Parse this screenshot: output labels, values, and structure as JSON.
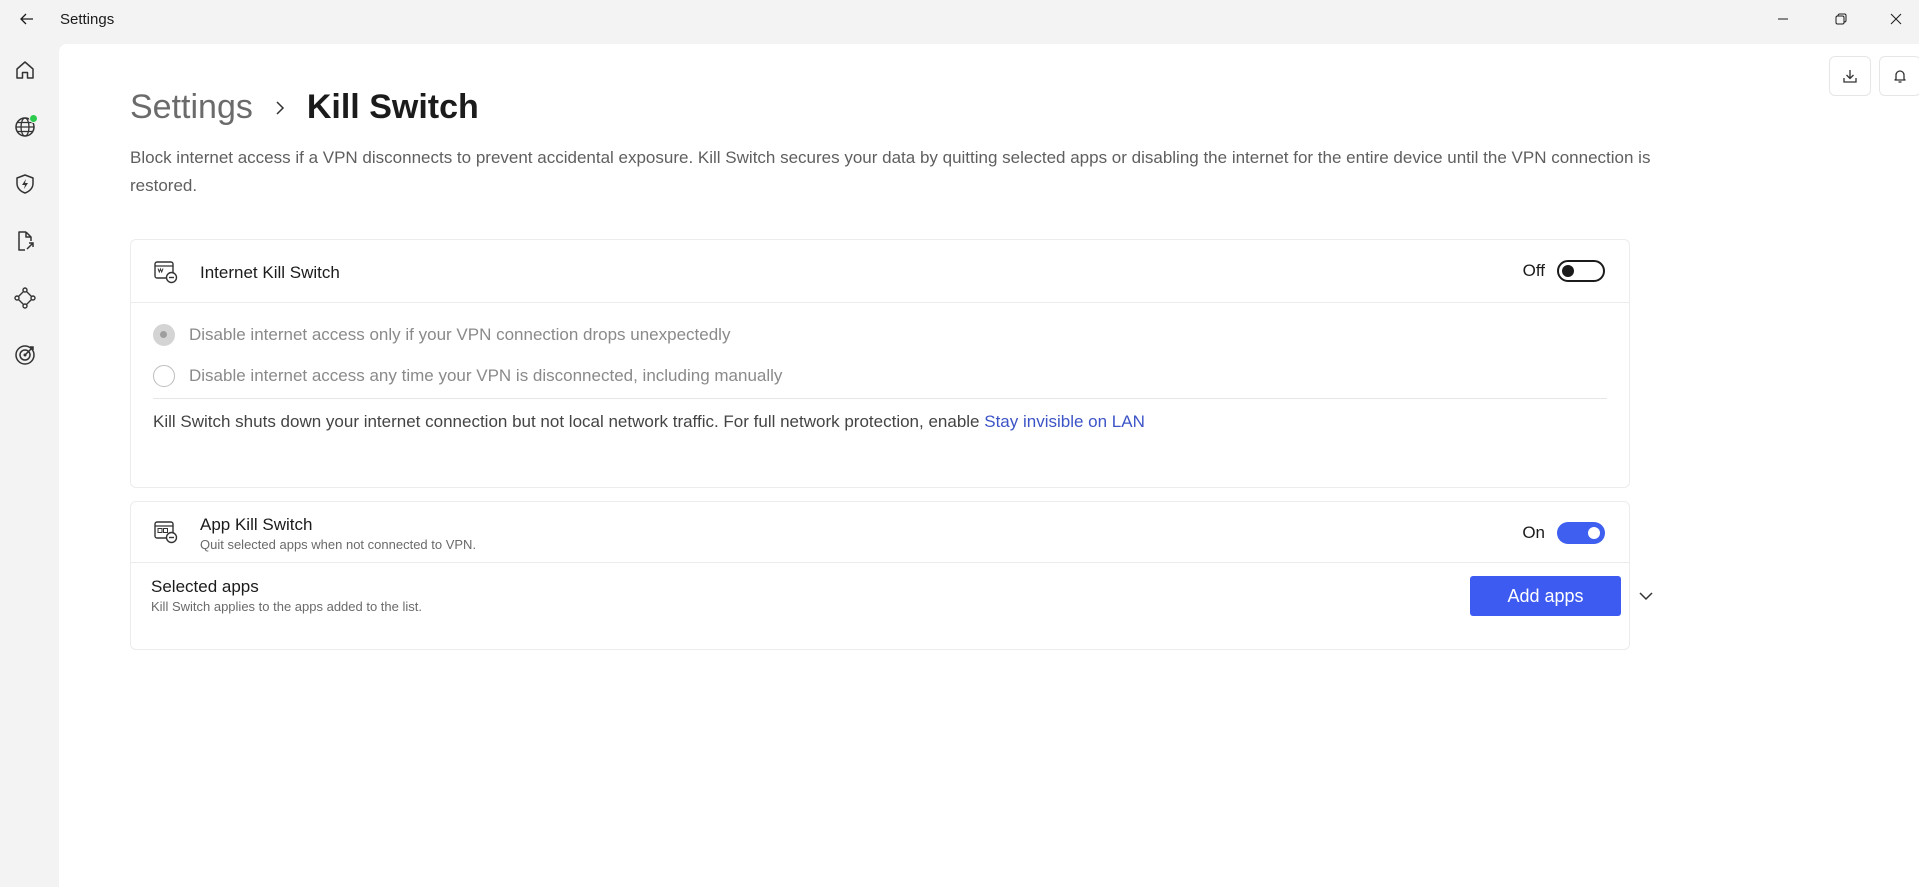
{
  "window": {
    "title": "Settings"
  },
  "sidebar": {
    "items": [
      {
        "name": "home-icon"
      },
      {
        "name": "globe-icon",
        "status_color": "#2bcb4e"
      },
      {
        "name": "shield-bolt-icon"
      },
      {
        "name": "file-share-icon"
      },
      {
        "name": "mesh-network-icon"
      },
      {
        "name": "target-icon"
      }
    ]
  },
  "header": {
    "breadcrumb_root": "Settings",
    "breadcrumb_current": "Kill Switch",
    "description": "Block internet access if a VPN disconnects to prevent accidental exposure. Kill Switch secures your data by quitting selected apps or disabling the internet for the entire device until the VPN connection is restored."
  },
  "internet_kill_switch": {
    "title": "Internet Kill Switch",
    "state_label": "Off",
    "enabled": false,
    "options": [
      {
        "label": "Disable internet access only if your VPN connection drops unexpectedly",
        "selected": true
      },
      {
        "label": "Disable internet access any time your VPN is disconnected, including manually",
        "selected": false
      }
    ],
    "note_text": "Kill Switch shuts down your internet connection but not local network traffic. For full network protection, enable ",
    "note_link": "Stay invisible on LAN"
  },
  "app_kill_switch": {
    "title": "App Kill Switch",
    "subtitle": "Quit selected apps when not connected to VPN.",
    "state_label": "On",
    "enabled": true,
    "selected_apps_title": "Selected apps",
    "selected_apps_subtitle": "Kill Switch applies to the apps added to the list.",
    "add_button_label": "Add apps"
  },
  "colors": {
    "accent": "#3d5af1",
    "link": "#3d54c7",
    "status_online": "#2bcb4e"
  }
}
